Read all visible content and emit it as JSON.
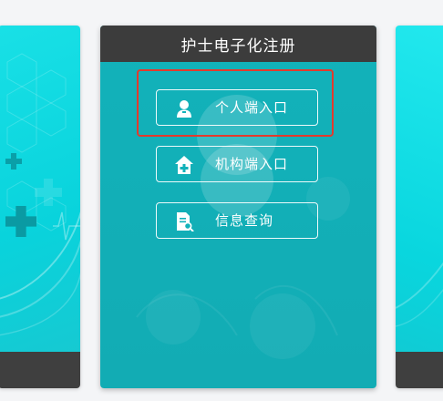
{
  "main_card": {
    "title": "护士电子化注册",
    "buttons": [
      {
        "label": "个人端入口",
        "icon": "person-icon"
      },
      {
        "label": "机构端入口",
        "icon": "hospital-icon"
      },
      {
        "label": "信息查询",
        "icon": "document-search-icon"
      }
    ]
  },
  "colors": {
    "card_teal": "#12b2ba",
    "header_dark": "#3c3c3c",
    "side_card_cyan": "#09d3dc",
    "highlight_red": "#e33a2c"
  }
}
